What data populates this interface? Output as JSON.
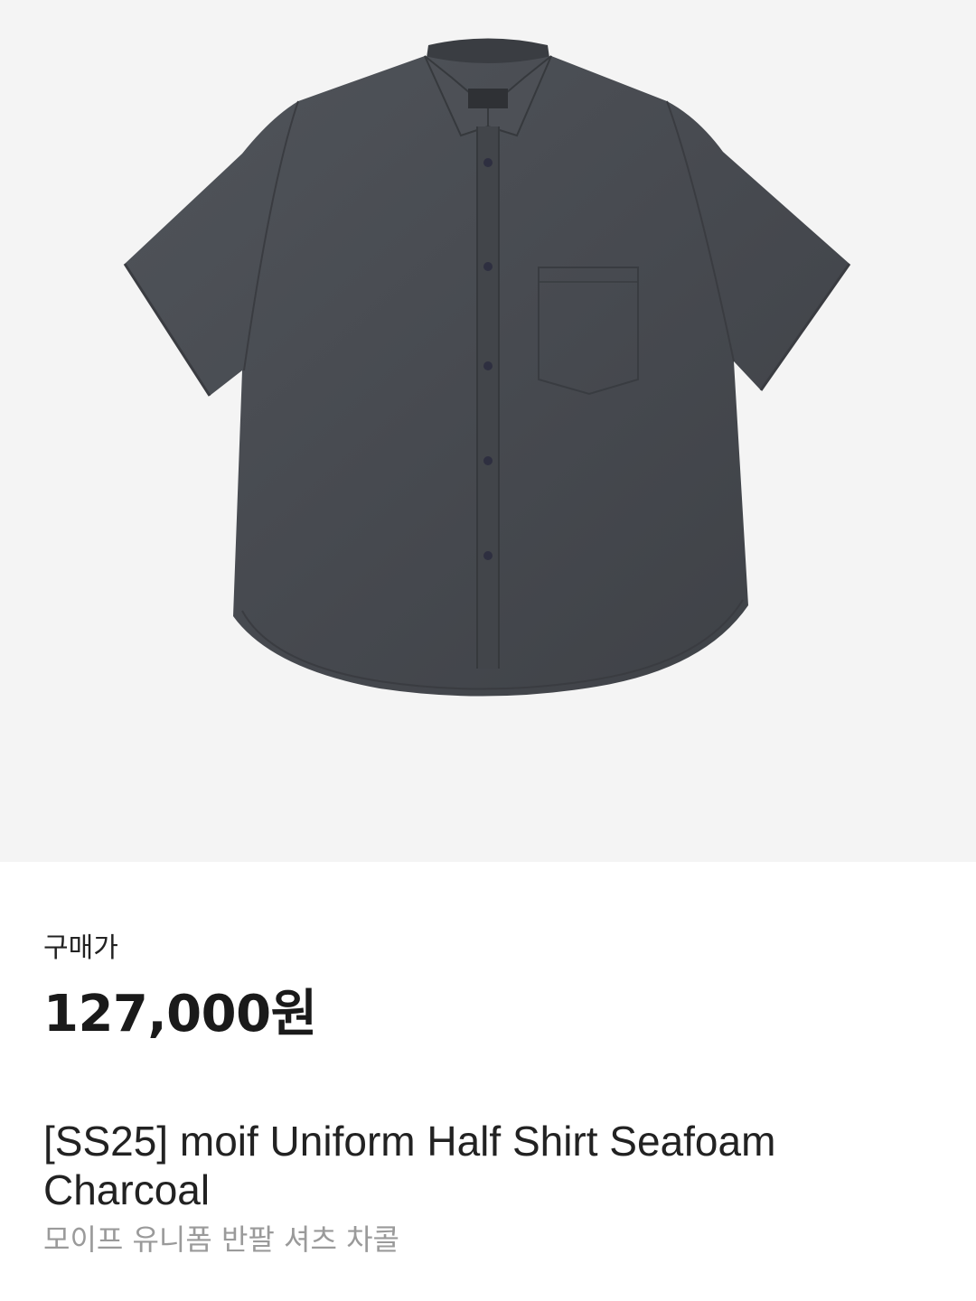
{
  "product": {
    "image_alt": "product-photo",
    "price_label": "구매가",
    "price": "127,000원",
    "title": "[SS25] moif Uniform Half Shirt Seafoam Charcoal",
    "subtitle": "모이프 유니폼 반팔 셔츠 차콜"
  },
  "colors": {
    "image_background": "#f4f4f4",
    "shirt": "#474a4f",
    "text_primary": "#1a1a1a",
    "text_secondary": "#9a9a9a"
  }
}
